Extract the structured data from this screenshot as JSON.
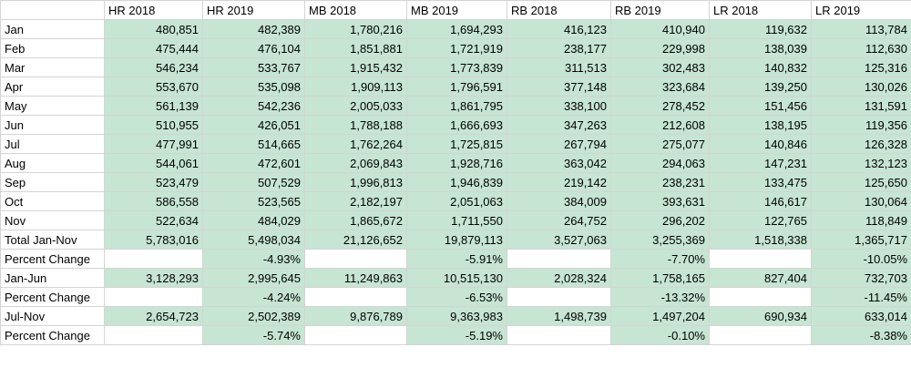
{
  "header": [
    "",
    "HR 2018",
    "HR 2019",
    "MB 2018",
    "MB 2019",
    "RB 2018",
    "RB 2019",
    "LR 2018",
    "LR 2019"
  ],
  "rows": [
    {
      "label": "Jan",
      "cells": [
        "480,851",
        "482,389",
        "1,780,216",
        "1,694,293",
        "416,123",
        "410,940",
        "119,632",
        "113,784"
      ]
    },
    {
      "label": "Feb",
      "cells": [
        "475,444",
        "476,104",
        "1,851,881",
        "1,721,919",
        "238,177",
        "229,998",
        "138,039",
        "112,630"
      ]
    },
    {
      "label": "Mar",
      "cells": [
        "546,234",
        "533,767",
        "1,915,432",
        "1,773,839",
        "311,513",
        "302,483",
        "140,832",
        "125,316"
      ]
    },
    {
      "label": "Apr",
      "cells": [
        "553,670",
        "535,098",
        "1,909,113",
        "1,796,591",
        "377,148",
        "323,684",
        "139,250",
        "130,026"
      ]
    },
    {
      "label": "May",
      "cells": [
        "561,139",
        "542,236",
        "2,005,033",
        "1,861,795",
        "338,100",
        "278,452",
        "151,456",
        "131,591"
      ]
    },
    {
      "label": "Jun",
      "cells": [
        "510,955",
        "426,051",
        "1,788,188",
        "1,666,693",
        "347,263",
        "212,608",
        "138,195",
        "119,356"
      ]
    },
    {
      "label": "Jul",
      "cells": [
        "477,991",
        "514,665",
        "1,762,264",
        "1,725,815",
        "267,794",
        "275,077",
        "140,846",
        "126,328"
      ]
    },
    {
      "label": "Aug",
      "cells": [
        "544,061",
        "472,601",
        "2,069,843",
        "1,928,716",
        "363,042",
        "294,063",
        "147,231",
        "132,123"
      ]
    },
    {
      "label": "Sep",
      "cells": [
        "523,479",
        "507,529",
        "1,996,813",
        "1,946,839",
        "219,142",
        "238,231",
        "133,475",
        "125,650"
      ]
    },
    {
      "label": "Oct",
      "cells": [
        "586,558",
        "523,565",
        "2,182,197",
        "2,051,063",
        "384,009",
        "393,631",
        "146,617",
        "130,064"
      ]
    },
    {
      "label": "Nov",
      "cells": [
        "522,634",
        "484,029",
        "1,865,672",
        "1,711,550",
        "264,752",
        "296,202",
        "122,765",
        "118,849"
      ]
    },
    {
      "label": "Total Jan-Nov",
      "cells": [
        "5,783,016",
        "5,498,034",
        "21,126,652",
        "19,879,113",
        "3,527,063",
        "3,255,369",
        "1,518,338",
        "1,365,717"
      ]
    },
    {
      "label": "Percent Change",
      "cells": [
        "",
        "-4.93%",
        "",
        "-5.91%",
        "",
        "-7.70%",
        "",
        "-10.05%"
      ]
    },
    {
      "label": "Jan-Jun",
      "cells": [
        "3,128,293",
        "2,995,645",
        "11,249,863",
        "10,515,130",
        "2,028,324",
        "1,758,165",
        "827,404",
        "732,703"
      ]
    },
    {
      "label": "Percent Change",
      "cells": [
        "",
        "-4.24%",
        "",
        "-6.53%",
        "",
        "-13.32%",
        "",
        "-11.45%"
      ]
    },
    {
      "label": "Jul-Nov",
      "cells": [
        "2,654,723",
        "2,502,389",
        "9,876,789",
        "9,363,983",
        "1,498,739",
        "1,497,204",
        "690,934",
        "633,014"
      ]
    },
    {
      "label": "Percent Change",
      "cells": [
        "",
        "-5.74%",
        "",
        "-5.19%",
        "",
        "-0.10%",
        "",
        "-8.38%"
      ]
    }
  ],
  "colors": {
    "fill": "#c6e5d3",
    "grid": "#d4d4d4"
  }
}
